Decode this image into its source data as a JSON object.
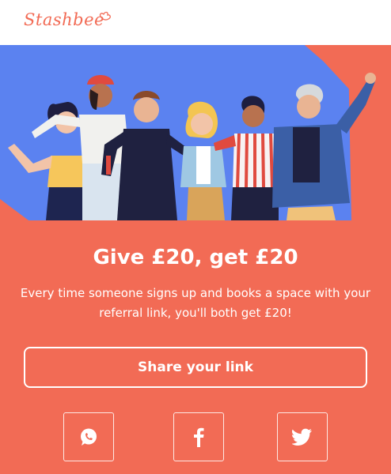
{
  "brand": {
    "logo_text": "Stashbee",
    "accent_color": "#f26b55",
    "hero_blue": "#5b82f0"
  },
  "referral": {
    "headline": "Give £20, get £20",
    "description": "Every time someone signs up and books a space with your referral link, you'll both get £20!",
    "share_label": "Share your link"
  },
  "social": [
    {
      "network": "WhatsApp",
      "icon": "whatsapp-icon"
    },
    {
      "network": "Facebook",
      "icon": "facebook-icon"
    },
    {
      "network": "Twitter",
      "icon": "twitter-icon"
    }
  ]
}
